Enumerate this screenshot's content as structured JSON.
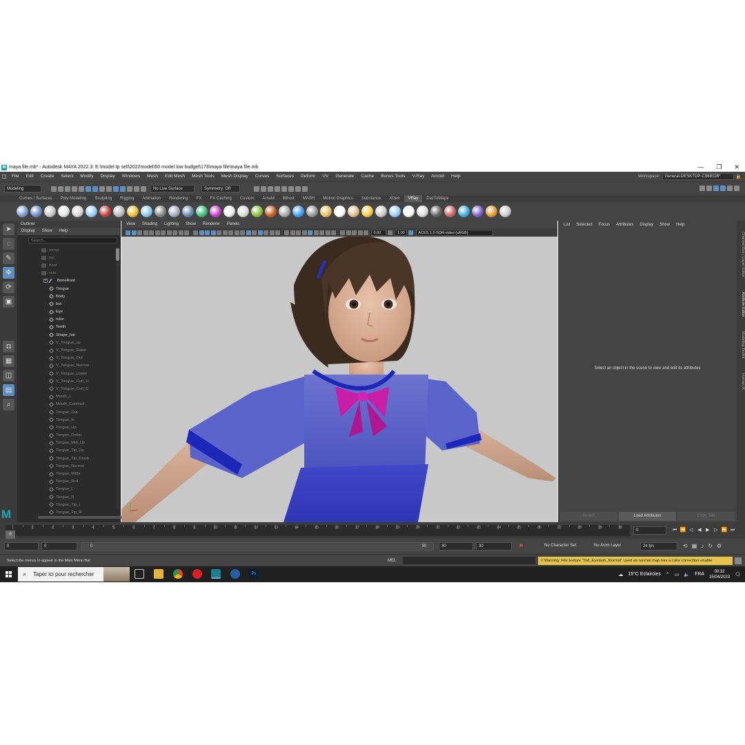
{
  "window": {
    "title": "maya file.mb* - Autodesk MAYA 2022.3: E:\\model tp sell\\2022model\\50 model low budget\\173\\maya file\\maya file.mb",
    "controls": [
      "—",
      "❐",
      "✕"
    ]
  },
  "menubar": {
    "items": [
      "File",
      "Edit",
      "Create",
      "Select",
      "Modify",
      "Display",
      "Windows",
      "Mesh",
      "Edit Mesh",
      "Mesh Tools",
      "Mesh Display",
      "Curves",
      "Surfaces",
      "Deform",
      "UV",
      "Generate",
      "Cache",
      "Bonus Tools",
      "V-Ray",
      "Arnold",
      "Help"
    ],
    "workspace_label": "Workspace:",
    "workspace_value": "General-DESKTOP-C96IEDB*"
  },
  "statusline": {
    "menuset": "Modeling",
    "live_surface": "No Live Surface",
    "symmetry": "Symmetry: Off"
  },
  "shelf": {
    "tabs": [
      "Curves / Surfaces",
      "Poly Modeling",
      "Sculpting",
      "Rigging",
      "Animation",
      "Rendering",
      "FX",
      "FX Caching",
      "Custom",
      "Arnold",
      "Bifrost",
      "MASH",
      "Motion Graphics",
      "Substance",
      "XGen",
      "VRay",
      "DazToMaya"
    ],
    "active_tab": "VRay"
  },
  "outliner": {
    "title": "Outliner",
    "menu": [
      "Display",
      "Show",
      "Help"
    ],
    "search_placeholder": "Search...",
    "cameras": [
      "persp",
      "top",
      "front",
      "side"
    ],
    "root": "BoneRoot",
    "meshes": [
      "Tongue",
      "Body",
      "bot",
      "Eye",
      "robe",
      "Teeth",
      "Shape_hai"
    ],
    "blendshapes": [
      "V_Tongue_up",
      "V_Tongue_Raise",
      "V_Tongue_Out",
      "V_Tongue_Narrow",
      "V_Tongue_Lower",
      "V_Tongue_Curl_U",
      "V_Tongue_Curl_D",
      "Mouth_L",
      "Mouth_Contract",
      "Tongue_Out",
      "Tongue_in",
      "Tongue_Up",
      "Tongue_Down",
      "Tongue_Mid_Up",
      "Tongue_Tip_Up",
      "Tongue_Tip_Down",
      "Tongue_Narrow",
      "Tongue_Wide",
      "Tongue_Roll",
      "Tongue_L",
      "Tongue_R",
      "Tongue_Tip_L",
      "Tongue_Tip_R"
    ]
  },
  "viewport": {
    "menu": [
      "View",
      "Shading",
      "Lighting",
      "Show",
      "Renderer",
      "Panels"
    ],
    "near": "0.00",
    "gamma": "1.00",
    "colorspace": "ACES 1.0 SDR-video (sRGB)",
    "background": "#c8c8c8"
  },
  "attribute_editor": {
    "menu": [
      "List",
      "Selected",
      "Focus",
      "Attributes",
      "Display",
      "Show",
      "Help"
    ],
    "message": "Select an object in the scene to view and edit its attributes",
    "buttons": [
      "Select",
      "Load Attributes",
      "Copy Tab"
    ],
    "side_tabs": [
      "Channel Box / Layer Editor",
      "Attribute Editor",
      "Modeling Toolkit",
      "Human IK"
    ]
  },
  "timeslider": {
    "ticks": [
      "1",
      "2",
      "3",
      "4",
      "5",
      "6",
      "7",
      "8",
      "9",
      "10",
      "11",
      "12",
      "13",
      "14",
      "15",
      "16",
      "17",
      "18",
      "19",
      "20",
      "21",
      "22",
      "23",
      "24",
      "25",
      "26",
      "27",
      "28",
      "29",
      "30"
    ],
    "current_frame": "0",
    "current_frame_field": "0"
  },
  "rangeslider": {
    "start": "0",
    "playback_start": "0",
    "range_left": "0",
    "range_right": "30",
    "playback_end": "30",
    "end": "30",
    "character_set": "No Character Set",
    "anim_layer": "No Anim Layer",
    "fps": "24 fps"
  },
  "cmdline": {
    "help": "Select the menus to appear in the Main Menu Bar",
    "mel": "MEL",
    "warning": "// Warning: File texture \"Std_Eyelash_Normal\" used as normal map has a color correction enable"
  },
  "taskbar": {
    "search": "Taper ici pour rechercher",
    "weather": "15°C  Eclaircies",
    "lang": "FRA",
    "time": "00:32",
    "date": "15/04/2023"
  },
  "colors": {
    "accent": "#5d8fc2",
    "maya_logo": "#16a8c0",
    "warning": "#e6c34d",
    "dress": "#4d55c8",
    "bow": "#c81ea8"
  }
}
